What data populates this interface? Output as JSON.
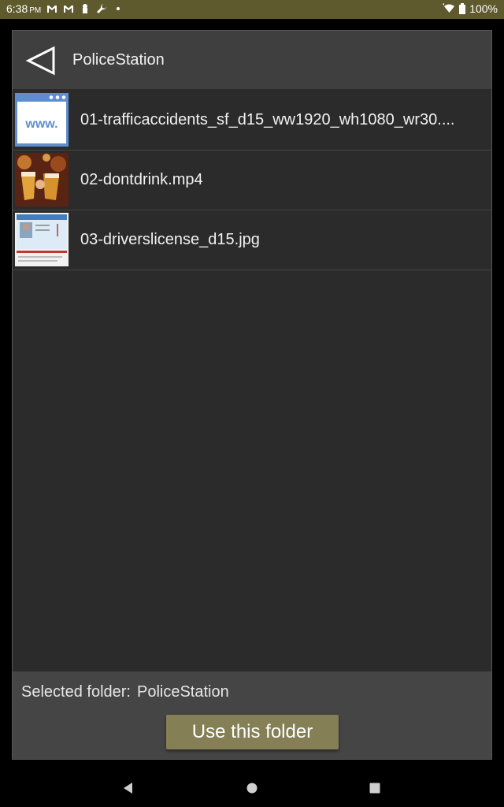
{
  "status_bar": {
    "time": "6:38",
    "ampm": "PM",
    "battery": "100%"
  },
  "header": {
    "title": "PoliceStation",
    "back_icon": "back-triangle-icon"
  },
  "files": [
    {
      "name": "01-trafficaccidents_sf_d15_ww1920_wh1080_wr30....",
      "thumb": "web-page-icon",
      "thumb_text": "www."
    },
    {
      "name": "02-dontdrink.mp4",
      "thumb": "video-thumbnail"
    },
    {
      "name": "03-driverslicense_d15.jpg",
      "thumb": "image-thumbnail"
    }
  ],
  "footer": {
    "selected_label": "Selected folder:",
    "selected_value": "PoliceStation",
    "use_button": "Use this folder"
  },
  "colors": {
    "status_bar": "#5f5a2e",
    "header": "#3f3f3f",
    "list_bg": "#2b2b2b",
    "footer": "#454545",
    "button": "#847f55"
  }
}
